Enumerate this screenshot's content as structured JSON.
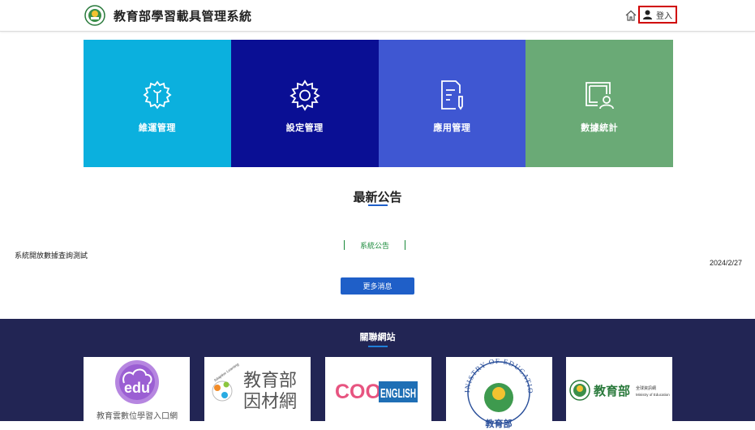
{
  "header": {
    "site_title": "教育部學習載具管理系統",
    "login_label": "登入",
    "icons": {
      "logo": "moe-emblem-icon",
      "home": "home-icon",
      "user": "user-icon"
    }
  },
  "tiles": [
    {
      "label": "維運管理",
      "icon": "gear-wrench-icon",
      "color": "#0bb0de"
    },
    {
      "label": "設定管理",
      "icon": "gear-icon",
      "color": "#0a0f94"
    },
    {
      "label": "應用管理",
      "icon": "document-edit-icon",
      "color": "#3f57d2"
    },
    {
      "label": "數據統計",
      "icon": "screen-user-icon",
      "color": "#6aaa76"
    }
  ],
  "news": {
    "title": "最新公告",
    "items": [
      {
        "tag": "系統公告",
        "text": "系統開放數據查詢測試",
        "date": "2024/2/27"
      }
    ],
    "more_label": "更多消息"
  },
  "links": {
    "title": "關聯網站",
    "cards": [
      {
        "label": "教育雲數位學習入口網",
        "badge": "edu"
      },
      {
        "label": "教育部因材網",
        "line1": "教育部",
        "line2": "因材網",
        "tag": "Adaptive Learning"
      },
      {
        "label": "COOL ENGLISH",
        "cool": "COOL",
        "english": "ENGLISH"
      },
      {
        "label": "MINISTRY OF EDUCATION",
        "ring_text": "MINISTRY OF EDUCATION",
        "bottom": "教育部"
      },
      {
        "label": "教育部 全球資訊網",
        "name": "教育部",
        "sub1": "全球資訊網",
        "sub2": "Ministry of Education"
      }
    ]
  },
  "colors": {
    "accent": "#1f5fc8",
    "footer_bg": "#222554",
    "tag_green": "#1a8a3a",
    "login_border": "#d00000"
  }
}
